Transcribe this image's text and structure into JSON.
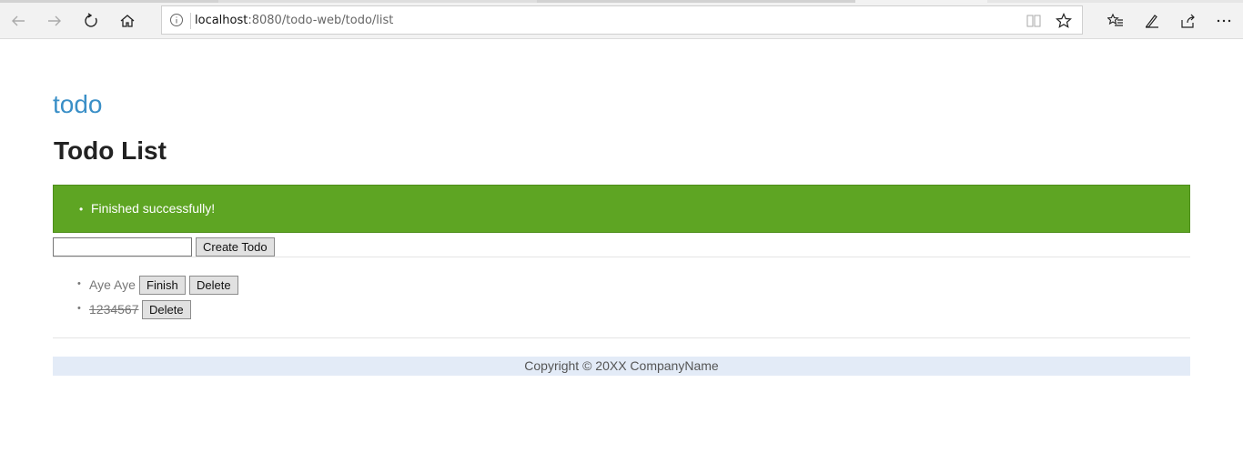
{
  "browser": {
    "url_host": "localhost",
    "url_rest": ":8080/todo-web/todo/list",
    "icons": {
      "back": "back-arrow-icon",
      "forward": "forward-arrow-icon",
      "refresh": "refresh-icon",
      "home": "home-icon",
      "info": "info-icon",
      "reader": "reading-view-icon",
      "favorite": "star-icon",
      "favorites_hub": "favorites-list-icon",
      "notes": "pen-icon",
      "share": "share-icon",
      "more": "more-icon"
    }
  },
  "page": {
    "brand": "todo",
    "title": "Todo List",
    "alert": {
      "messages": [
        "Finished successfully!"
      ],
      "color": "#5ea523"
    },
    "form": {
      "input_value": "",
      "create_label": "Create Todo"
    },
    "todos": [
      {
        "text": "Aye Aye",
        "finished": false,
        "finish_label": "Finish",
        "delete_label": "Delete"
      },
      {
        "text": "1234567",
        "finished": true,
        "delete_label": "Delete"
      }
    ],
    "footer": "Copyright © 20XX CompanyName"
  }
}
